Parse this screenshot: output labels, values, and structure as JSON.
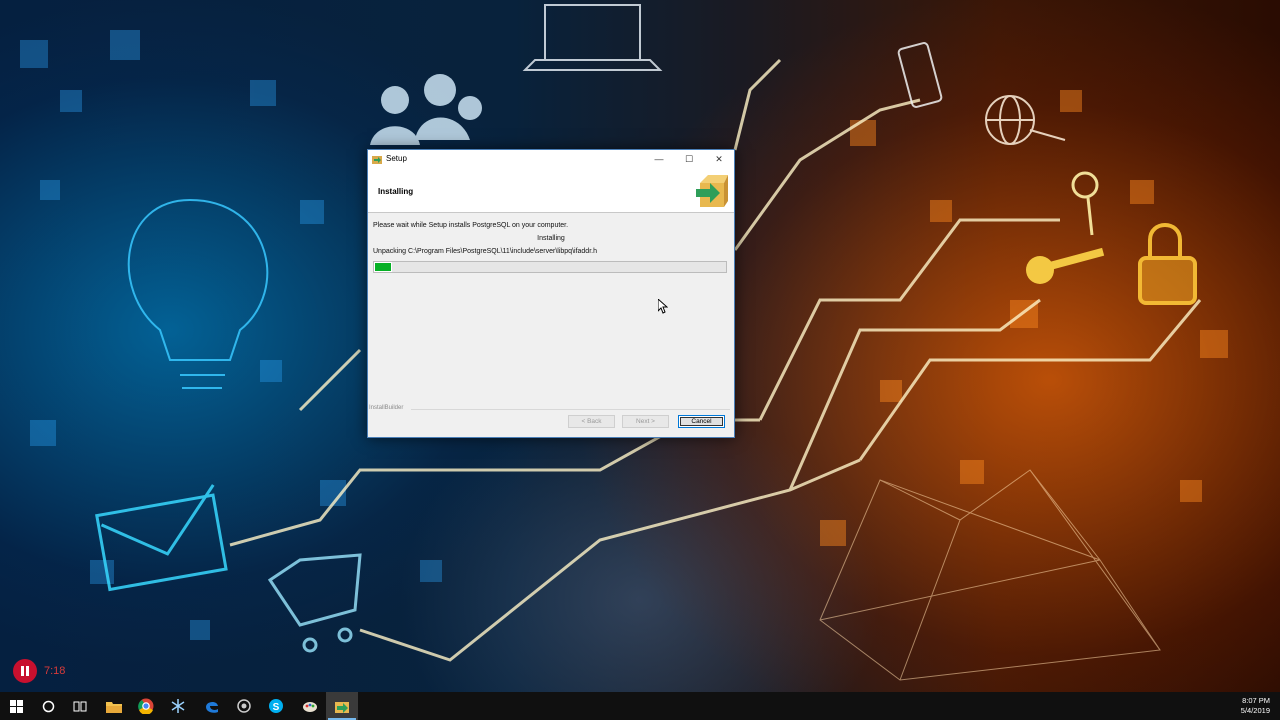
{
  "window": {
    "title": "Setup",
    "controls": {
      "minimize": "—",
      "maximize": "☐",
      "close": "✕"
    }
  },
  "installer": {
    "header_title": "Installing",
    "info_text": "Please wait while Setup installs PostgreSQL on your computer.",
    "status_text": "Installing",
    "file_text": "Unpacking C:\\Program Files\\PostgreSQL\\11\\include\\server\\libpq\\ifaddr.h",
    "progress_fraction": 0.05,
    "progress_color": "#06b025",
    "brand": "InstallBuilder",
    "buttons": {
      "back": "< Back",
      "next": "Next >",
      "cancel": "Cancel"
    }
  },
  "recorder": {
    "time": "7:18",
    "color": "#c8102e"
  },
  "taskbar": {
    "items": [
      {
        "icon": "windows-start-icon"
      },
      {
        "icon": "search-circle-icon"
      },
      {
        "icon": "task-view-icon"
      },
      {
        "icon": "file-explorer-icon"
      },
      {
        "icon": "chrome-icon"
      },
      {
        "icon": "snowflake-app-icon"
      },
      {
        "icon": "edge-icon"
      },
      {
        "icon": "cortana-circle-icon"
      },
      {
        "icon": "skype-icon"
      },
      {
        "icon": "paint-icon"
      },
      {
        "icon": "setup-installer-icon"
      }
    ],
    "clock_time": "8:07 PM",
    "clock_date": "5/4/2019"
  }
}
